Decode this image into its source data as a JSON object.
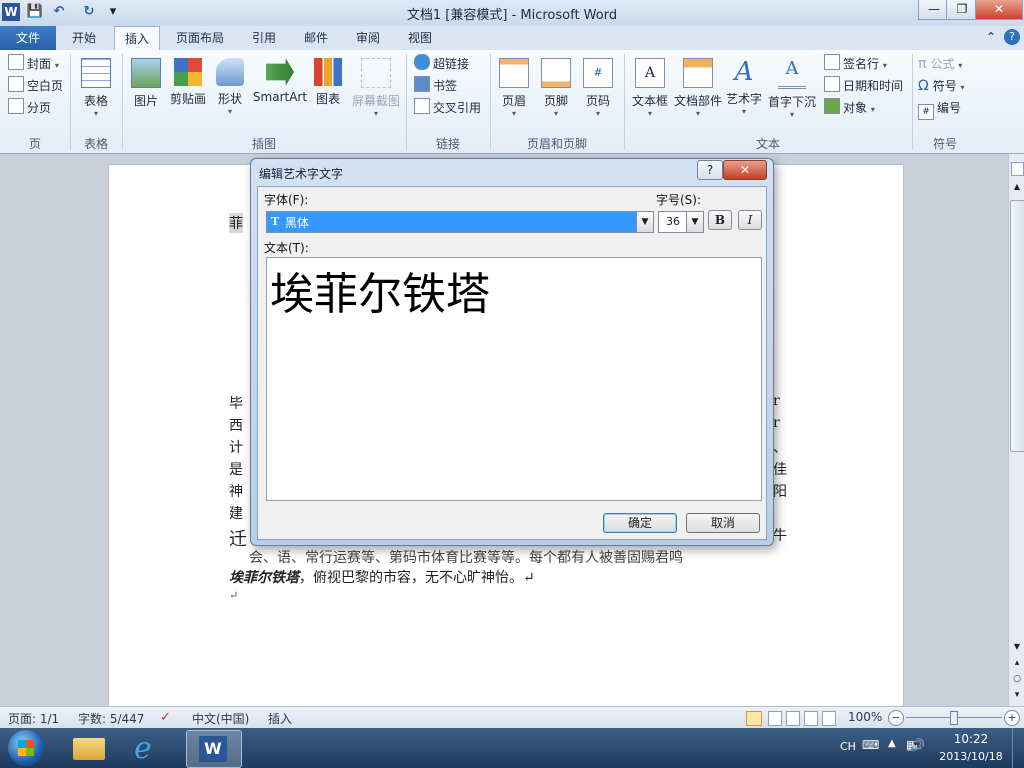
{
  "window": {
    "title": "文档1 [兼容模式] - Microsoft Word",
    "app_icon": "W",
    "min_glyph": "—",
    "max_glyph": "❐",
    "close_glyph": "✕"
  },
  "qat": {
    "save_icon": "💾",
    "undo_icon": "↶",
    "redo_icon": "↻",
    "customize_icon": "▾"
  },
  "tabs": [
    "文件",
    "开始",
    "插入",
    "页面布局",
    "引用",
    "邮件",
    "审阅",
    "视图"
  ],
  "ribbon_right": {
    "minimize_icon": "⌃",
    "help_icon": "?"
  },
  "ribbon": {
    "pages": {
      "label": "页",
      "items": [
        "封面",
        "空白页",
        "分页"
      ]
    },
    "tables": {
      "label": "表格",
      "items": [
        "表格"
      ]
    },
    "illustrations": {
      "label": "插图",
      "items": [
        "图片",
        "剪贴画",
        "形状",
        "SmartArt",
        "图表",
        "屏幕截图"
      ]
    },
    "links": {
      "label": "链接",
      "items": [
        "超链接",
        "书签",
        "交叉引用"
      ]
    },
    "header_footer": {
      "label": "页眉和页脚",
      "items": [
        "页眉",
        "页脚",
        "页码"
      ]
    },
    "text": {
      "label": "文本",
      "items": [
        "文本框",
        "文档部件",
        "艺术字",
        "首字下沉"
      ],
      "side_items": [
        "签名行",
        "日期和时间",
        "对象"
      ]
    },
    "symbols": {
      "label": "符号",
      "items": [
        "公式",
        "符号",
        "编号"
      ]
    }
  },
  "document": {
    "fragment_top": "菲",
    "left_fragments": [
      "毕",
      "西",
      "计",
      "是",
      "神",
      "建",
      "迁"
    ],
    "right_fragments": [
      "r",
      "r",
      "、",
      "佳",
      "阳",
      "",
      "牛"
    ],
    "line_partial": "会、语、常行运赛等、第码市体育比赛等等。每个都有人被善固赐君鸣",
    "line_last_bold": "埃菲尔铁塔",
    "line_last_rest": "，俯视巴黎的市容，无不心旷神怡。↵",
    "para_mark": "↵"
  },
  "dialog": {
    "title": "编辑艺术字文字",
    "help_label": "?",
    "close_label": "✕",
    "font_label": "字体(F):",
    "font_value": "黑体",
    "font_icon": "T",
    "size_label": "字号(S):",
    "size_value": "36",
    "bold_label": "B",
    "italic_label": "I",
    "text_label": "文本(T):",
    "text_value": "埃菲尔铁塔",
    "ok_label": "确定",
    "cancel_label": "取消"
  },
  "status": {
    "page": "页面: 1/1",
    "words": "字数: 5/447",
    "language": "中文(中国)",
    "mode": "插入",
    "zoom": "100%",
    "zoom_out": "−",
    "zoom_in": "+"
  },
  "taskbar": {
    "ime": "CH",
    "time": "10:22",
    "date": "2013/10/18"
  }
}
